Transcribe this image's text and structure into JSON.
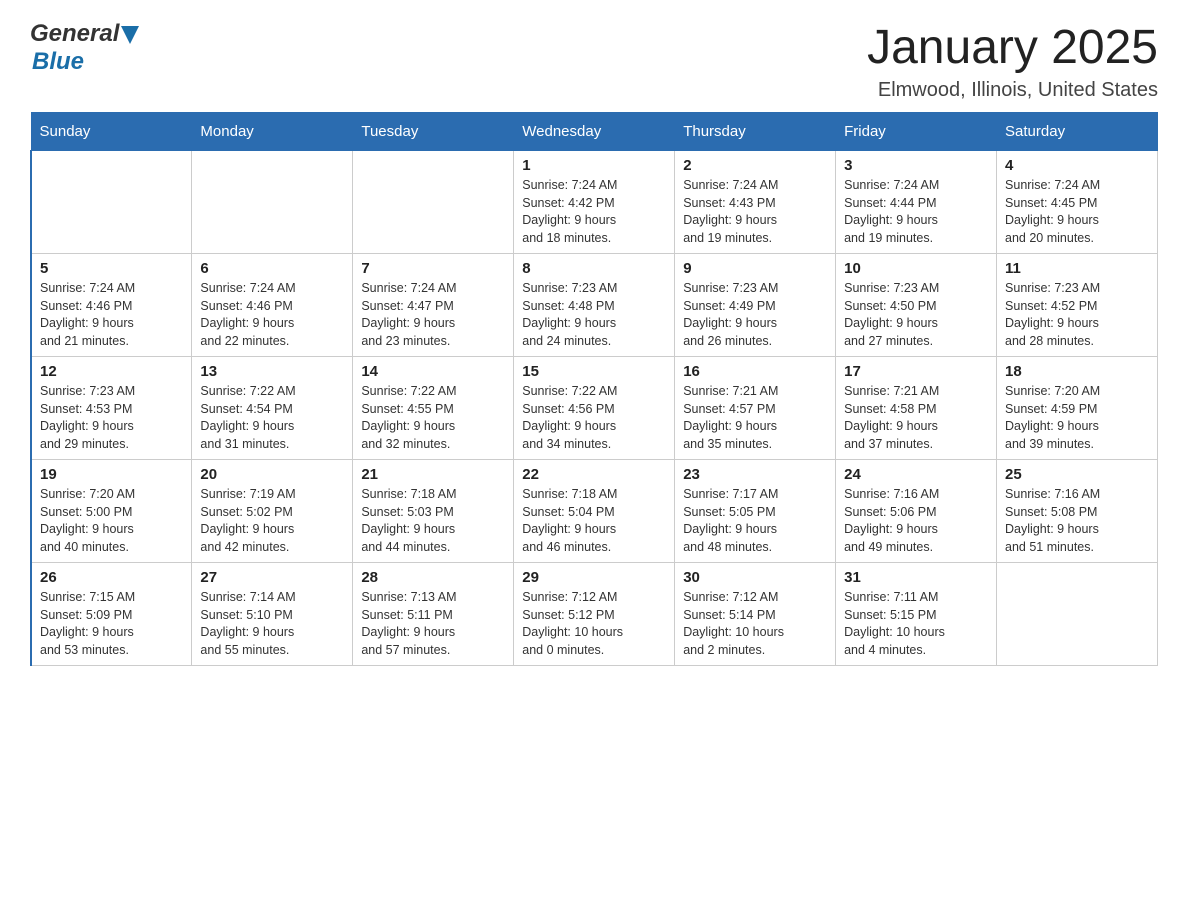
{
  "header": {
    "logo": {
      "general": "General",
      "blue": "Blue",
      "aria": "GeneralBlue logo"
    },
    "title": "January 2025",
    "location": "Elmwood, Illinois, United States"
  },
  "calendar": {
    "days_of_week": [
      "Sunday",
      "Monday",
      "Tuesday",
      "Wednesday",
      "Thursday",
      "Friday",
      "Saturday"
    ],
    "weeks": [
      [
        {
          "day": "",
          "info": ""
        },
        {
          "day": "",
          "info": ""
        },
        {
          "day": "",
          "info": ""
        },
        {
          "day": "1",
          "info": "Sunrise: 7:24 AM\nSunset: 4:42 PM\nDaylight: 9 hours\nand 18 minutes."
        },
        {
          "day": "2",
          "info": "Sunrise: 7:24 AM\nSunset: 4:43 PM\nDaylight: 9 hours\nand 19 minutes."
        },
        {
          "day": "3",
          "info": "Sunrise: 7:24 AM\nSunset: 4:44 PM\nDaylight: 9 hours\nand 19 minutes."
        },
        {
          "day": "4",
          "info": "Sunrise: 7:24 AM\nSunset: 4:45 PM\nDaylight: 9 hours\nand 20 minutes."
        }
      ],
      [
        {
          "day": "5",
          "info": "Sunrise: 7:24 AM\nSunset: 4:46 PM\nDaylight: 9 hours\nand 21 minutes."
        },
        {
          "day": "6",
          "info": "Sunrise: 7:24 AM\nSunset: 4:46 PM\nDaylight: 9 hours\nand 22 minutes."
        },
        {
          "day": "7",
          "info": "Sunrise: 7:24 AM\nSunset: 4:47 PM\nDaylight: 9 hours\nand 23 minutes."
        },
        {
          "day": "8",
          "info": "Sunrise: 7:23 AM\nSunset: 4:48 PM\nDaylight: 9 hours\nand 24 minutes."
        },
        {
          "day": "9",
          "info": "Sunrise: 7:23 AM\nSunset: 4:49 PM\nDaylight: 9 hours\nand 26 minutes."
        },
        {
          "day": "10",
          "info": "Sunrise: 7:23 AM\nSunset: 4:50 PM\nDaylight: 9 hours\nand 27 minutes."
        },
        {
          "day": "11",
          "info": "Sunrise: 7:23 AM\nSunset: 4:52 PM\nDaylight: 9 hours\nand 28 minutes."
        }
      ],
      [
        {
          "day": "12",
          "info": "Sunrise: 7:23 AM\nSunset: 4:53 PM\nDaylight: 9 hours\nand 29 minutes."
        },
        {
          "day": "13",
          "info": "Sunrise: 7:22 AM\nSunset: 4:54 PM\nDaylight: 9 hours\nand 31 minutes."
        },
        {
          "day": "14",
          "info": "Sunrise: 7:22 AM\nSunset: 4:55 PM\nDaylight: 9 hours\nand 32 minutes."
        },
        {
          "day": "15",
          "info": "Sunrise: 7:22 AM\nSunset: 4:56 PM\nDaylight: 9 hours\nand 34 minutes."
        },
        {
          "day": "16",
          "info": "Sunrise: 7:21 AM\nSunset: 4:57 PM\nDaylight: 9 hours\nand 35 minutes."
        },
        {
          "day": "17",
          "info": "Sunrise: 7:21 AM\nSunset: 4:58 PM\nDaylight: 9 hours\nand 37 minutes."
        },
        {
          "day": "18",
          "info": "Sunrise: 7:20 AM\nSunset: 4:59 PM\nDaylight: 9 hours\nand 39 minutes."
        }
      ],
      [
        {
          "day": "19",
          "info": "Sunrise: 7:20 AM\nSunset: 5:00 PM\nDaylight: 9 hours\nand 40 minutes."
        },
        {
          "day": "20",
          "info": "Sunrise: 7:19 AM\nSunset: 5:02 PM\nDaylight: 9 hours\nand 42 minutes."
        },
        {
          "day": "21",
          "info": "Sunrise: 7:18 AM\nSunset: 5:03 PM\nDaylight: 9 hours\nand 44 minutes."
        },
        {
          "day": "22",
          "info": "Sunrise: 7:18 AM\nSunset: 5:04 PM\nDaylight: 9 hours\nand 46 minutes."
        },
        {
          "day": "23",
          "info": "Sunrise: 7:17 AM\nSunset: 5:05 PM\nDaylight: 9 hours\nand 48 minutes."
        },
        {
          "day": "24",
          "info": "Sunrise: 7:16 AM\nSunset: 5:06 PM\nDaylight: 9 hours\nand 49 minutes."
        },
        {
          "day": "25",
          "info": "Sunrise: 7:16 AM\nSunset: 5:08 PM\nDaylight: 9 hours\nand 51 minutes."
        }
      ],
      [
        {
          "day": "26",
          "info": "Sunrise: 7:15 AM\nSunset: 5:09 PM\nDaylight: 9 hours\nand 53 minutes."
        },
        {
          "day": "27",
          "info": "Sunrise: 7:14 AM\nSunset: 5:10 PM\nDaylight: 9 hours\nand 55 minutes."
        },
        {
          "day": "28",
          "info": "Sunrise: 7:13 AM\nSunset: 5:11 PM\nDaylight: 9 hours\nand 57 minutes."
        },
        {
          "day": "29",
          "info": "Sunrise: 7:12 AM\nSunset: 5:12 PM\nDaylight: 10 hours\nand 0 minutes."
        },
        {
          "day": "30",
          "info": "Sunrise: 7:12 AM\nSunset: 5:14 PM\nDaylight: 10 hours\nand 2 minutes."
        },
        {
          "day": "31",
          "info": "Sunrise: 7:11 AM\nSunset: 5:15 PM\nDaylight: 10 hours\nand 4 minutes."
        },
        {
          "day": "",
          "info": ""
        }
      ]
    ]
  }
}
